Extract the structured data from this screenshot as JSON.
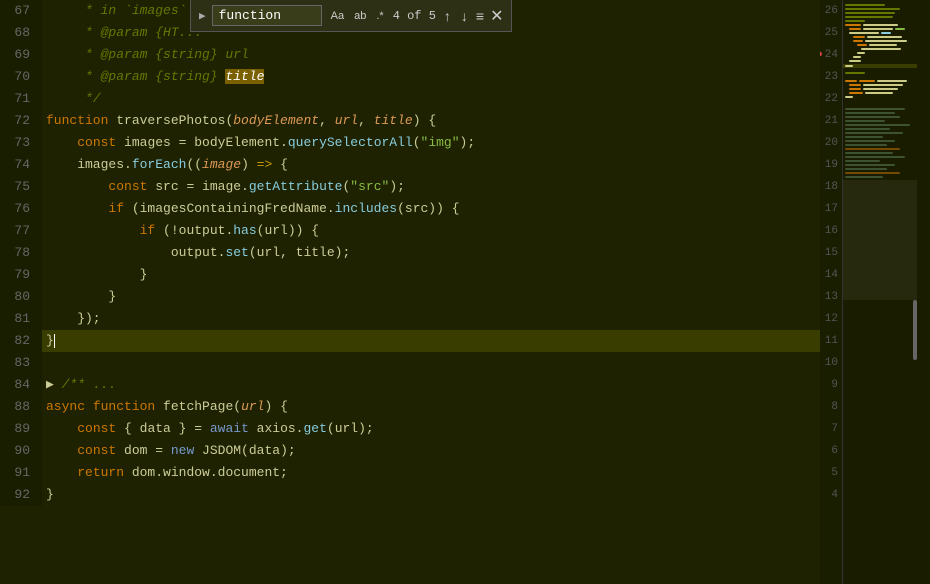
{
  "editor": {
    "background": "#1e2200",
    "find_bar": {
      "visible": true,
      "query": "function",
      "match_case_label": "Aa",
      "whole_word_label": "ab",
      "regex_label": ".*",
      "count_label": "4 of 5",
      "up_label": "↑",
      "down_label": "↓",
      "menu_label": "≡",
      "close_label": "✕"
    },
    "lines": [
      {
        "num": 67,
        "tokens": [
          {
            "t": "comment",
            "v": "     * in `images`"
          }
        ]
      },
      {
        "num": 68,
        "tokens": [
          {
            "t": "comment",
            "v": "     * @param {HT..."
          }
        ]
      },
      {
        "num": 69,
        "tokens": [
          {
            "t": "comment",
            "v": "     * @param {string} url"
          }
        ]
      },
      {
        "num": 70,
        "tokens": [
          {
            "t": "comment",
            "v": "     * @param {string} title"
          }
        ]
      },
      {
        "num": 71,
        "tokens": [
          {
            "t": "comment",
            "v": "     */"
          }
        ]
      },
      {
        "num": 72,
        "tokens": [
          {
            "t": "kw",
            "v": "function"
          },
          {
            "t": "plain",
            "v": " traversePhotos("
          },
          {
            "t": "param",
            "v": "bodyElement"
          },
          {
            "t": "plain",
            "v": ", "
          },
          {
            "t": "param",
            "v": "url"
          },
          {
            "t": "plain",
            "v": ", "
          },
          {
            "t": "param",
            "v": "title"
          },
          {
            "t": "plain",
            "v": ") {"
          }
        ]
      },
      {
        "num": 73,
        "tokens": [
          {
            "t": "plain",
            "v": "    "
          },
          {
            "t": "kw",
            "v": "const"
          },
          {
            "t": "plain",
            "v": " images = bodyElement."
          },
          {
            "t": "method",
            "v": "querySelectorAll"
          },
          {
            "t": "plain",
            "v": "("
          },
          {
            "t": "str",
            "v": "\"img\""
          },
          {
            "t": "plain",
            "v": ");"
          }
        ]
      },
      {
        "num": 74,
        "tokens": [
          {
            "t": "plain",
            "v": "    images."
          },
          {
            "t": "method",
            "v": "forEach"
          },
          {
            "t": "plain",
            "v": "(("
          },
          {
            "t": "param",
            "v": "image"
          },
          {
            "t": "plain",
            "v": ") "
          },
          {
            "t": "arrow",
            "v": "=>"
          },
          {
            "t": "plain",
            "v": " {"
          }
        ]
      },
      {
        "num": 75,
        "tokens": [
          {
            "t": "plain",
            "v": "        "
          },
          {
            "t": "kw",
            "v": "const"
          },
          {
            "t": "plain",
            "v": " src = image."
          },
          {
            "t": "method",
            "v": "getAttribute"
          },
          {
            "t": "plain",
            "v": "("
          },
          {
            "t": "str",
            "v": "\"src\""
          },
          {
            "t": "plain",
            "v": ");"
          }
        ]
      },
      {
        "num": 76,
        "tokens": [
          {
            "t": "plain",
            "v": "        "
          },
          {
            "t": "kw",
            "v": "if"
          },
          {
            "t": "plain",
            "v": " (imagesContainingFredName."
          },
          {
            "t": "method",
            "v": "includes"
          },
          {
            "t": "plain",
            "v": "(src)) {"
          }
        ]
      },
      {
        "num": 77,
        "tokens": [
          {
            "t": "plain",
            "v": "            "
          },
          {
            "t": "kw",
            "v": "if"
          },
          {
            "t": "plain",
            "v": " (!output."
          },
          {
            "t": "method",
            "v": "has"
          },
          {
            "t": "plain",
            "v": "(url)) {"
          }
        ]
      },
      {
        "num": 78,
        "tokens": [
          {
            "t": "plain",
            "v": "                output."
          },
          {
            "t": "method",
            "v": "set"
          },
          {
            "t": "plain",
            "v": "(url, title);"
          }
        ]
      },
      {
        "num": 79,
        "tokens": [
          {
            "t": "plain",
            "v": "            }"
          }
        ]
      },
      {
        "num": 80,
        "tokens": [
          {
            "t": "plain",
            "v": "        }"
          }
        ]
      },
      {
        "num": 81,
        "tokens": [
          {
            "t": "plain",
            "v": "    });"
          }
        ]
      },
      {
        "num": 82,
        "tokens": [
          {
            "t": "plain",
            "v": "}"
          }
        ],
        "current": true
      },
      {
        "num": 83,
        "tokens": []
      },
      {
        "num": 84,
        "tokens": [
          {
            "t": "plain",
            "v": "> "
          },
          {
            "t": "comment",
            "v": "/** ..."
          }
        ]
      },
      {
        "num": 88,
        "tokens": [
          {
            "t": "kw",
            "v": "async"
          },
          {
            "t": "plain",
            "v": " "
          },
          {
            "t": "kw",
            "v": "function"
          },
          {
            "t": "plain",
            "v": " fetchPage("
          },
          {
            "t": "param",
            "v": "url"
          },
          {
            "t": "plain",
            "v": ") {"
          }
        ]
      },
      {
        "num": 89,
        "tokens": [
          {
            "t": "plain",
            "v": "    "
          },
          {
            "t": "kw",
            "v": "const"
          },
          {
            "t": "plain",
            "v": " { data } = "
          },
          {
            "t": "kw-blue",
            "v": "await"
          },
          {
            "t": "plain",
            "v": " axios."
          },
          {
            "t": "method",
            "v": "get"
          },
          {
            "t": "plain",
            "v": "(url);"
          }
        ]
      },
      {
        "num": 90,
        "tokens": [
          {
            "t": "plain",
            "v": "    "
          },
          {
            "t": "kw",
            "v": "const"
          },
          {
            "t": "plain",
            "v": " dom = "
          },
          {
            "t": "kw-blue",
            "v": "new"
          },
          {
            "t": "plain",
            "v": " JSDOM(data);"
          }
        ]
      },
      {
        "num": 91,
        "tokens": [
          {
            "t": "plain",
            "v": "    "
          },
          {
            "t": "kw",
            "v": "return"
          },
          {
            "t": "plain",
            "v": " dom.window.document;"
          }
        ]
      },
      {
        "num": 92,
        "tokens": [
          {
            "t": "plain",
            "v": "}"
          }
        ]
      }
    ],
    "right_numbers": [
      {
        "num": 26,
        "dot": false
      },
      {
        "num": 25,
        "dot": false
      },
      {
        "num": 24,
        "dot": true
      },
      {
        "num": 23,
        "dot": false
      },
      {
        "num": 22,
        "dot": false
      },
      {
        "num": 21,
        "dot": false
      },
      {
        "num": 20,
        "dot": false
      },
      {
        "num": 19,
        "dot": false
      },
      {
        "num": 18,
        "dot": false
      },
      {
        "num": 17,
        "dot": false
      },
      {
        "num": 16,
        "dot": false
      },
      {
        "num": 15,
        "dot": false
      },
      {
        "num": 14,
        "dot": false
      },
      {
        "num": 13,
        "dot": false
      },
      {
        "num": 12,
        "dot": false
      },
      {
        "num": 11,
        "dot": false
      },
      {
        "num": 10,
        "dot": false
      },
      {
        "num": 9,
        "dot": false
      },
      {
        "num": 8,
        "dot": false
      },
      {
        "num": 7,
        "dot": false
      },
      {
        "num": 6,
        "dot": false
      },
      {
        "num": 5,
        "dot": false
      },
      {
        "num": 4,
        "dot": false
      }
    ]
  }
}
